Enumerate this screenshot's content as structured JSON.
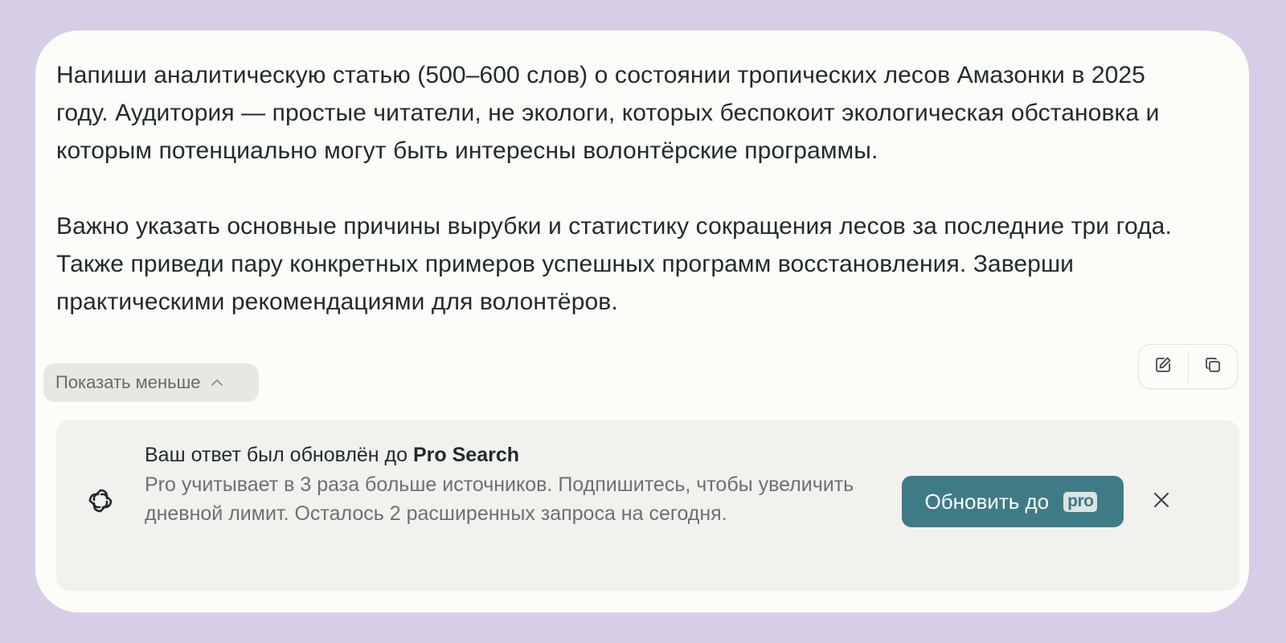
{
  "query": {
    "paragraph1": "Напиши аналитическую статью (500–600 слов) о состоянии тропических лесов Амазонки в 2025 году. Аудитория — простые читатели, не экологи, которых беспокоит экологическая обстановка и которым потенциально могут быть интересны волонтёрские программы.",
    "paragraph2": "Важно указать основные причины вырубки и статистику сокращения лесов за последние три года. Также приведи пару конкретных примеров успешных программ восстановления. Заверши практическими рекомендациями для волонтёров."
  },
  "show_less": {
    "label": "Показать меньше",
    "icon": "chevron-up-icon"
  },
  "actions": {
    "edit_icon": "edit-icon",
    "copy_icon": "copy-icon"
  },
  "banner": {
    "title_prefix": "Ваш ответ был обновлён до ",
    "title_emphasis": "Pro Search",
    "description": "Pro учитывает в 3 раза больше источников. Подпишитесь, чтобы увеличить дневной лимит. Осталось 2 расширенных запроса на сегодня.",
    "button_label": "Обновить до",
    "button_badge": "pro",
    "logo_icon": "perplexity-logo-icon",
    "close_icon": "close-icon"
  },
  "colors": {
    "background": "#d8cde6",
    "card": "#fcfcf9",
    "banner": "#f1f2ee",
    "accent": "#3f7b86",
    "text": "#1f2b2e",
    "muted": "#6b7172"
  }
}
